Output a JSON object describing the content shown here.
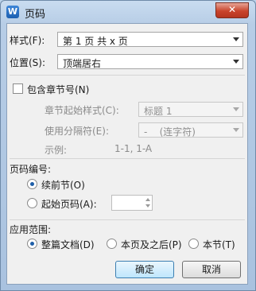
{
  "window": {
    "title": "页码",
    "logo": "W",
    "close_glyph": "✕"
  },
  "style_row": {
    "label": "样式(F):",
    "value": "第 1 页 共 x 页"
  },
  "position_row": {
    "label": "位置(S):",
    "value": "顶端居右"
  },
  "chapter": {
    "checkbox_label": "包含章节号(N)",
    "checked": false,
    "start_style_label": "章节起始样式(C):",
    "start_style_value": "标题 1",
    "separator_label": "使用分隔符(E):",
    "separator_value": "-    (连字符)",
    "example_label": "示例:",
    "example_value": "1-1, 1-A"
  },
  "numbering": {
    "section_title": "页码编号:",
    "continue_label": "续前节(O)",
    "start_label": "起始页码(A):",
    "selected": "continue",
    "start_value": ""
  },
  "apply": {
    "section_title": "应用范围:",
    "options": [
      "整篇文档(D)",
      "本页及之后(P)",
      "本节(T)"
    ],
    "selected": "整篇文档(D)"
  },
  "buttons": {
    "ok": "确定",
    "cancel": "取消"
  },
  "icons": {
    "logo": "wps-writer-logo-icon",
    "close": "close-icon",
    "dropdown": "chevron-down-icon",
    "spin_up": "spin-up-icon",
    "spin_down": "spin-down-icon"
  }
}
